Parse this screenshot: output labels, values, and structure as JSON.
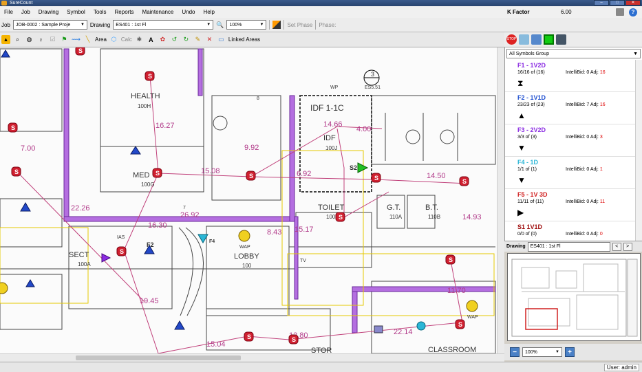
{
  "app": {
    "title": "SureCount"
  },
  "menu": [
    "File",
    "Job",
    "Drawing",
    "Symbol",
    "Tools",
    "Reports",
    "Maintenance",
    "Undo",
    "Help"
  ],
  "kfactor": {
    "label": "K Factor",
    "value": "6.00"
  },
  "toolbar": {
    "job_label": "Job",
    "job_value": "JOB-0002 : Sample Proje",
    "drawing_label": "Drawing",
    "drawing_value": "ES401 : 1st Fl",
    "zoom_value": "100%",
    "set_phase": "Set Phase",
    "phase_label": "Phase:",
    "area_label": "Area",
    "calc_label": "Calc",
    "linked_areas": "Linked Areas"
  },
  "symbols": {
    "group": "All Symbols Group",
    "items": [
      {
        "name": "F1 - 1V2D",
        "color": "#8a2be2",
        "count": "16/16 of (16)",
        "ib": "IntelliBid: 0",
        "adj_label": "Adj:",
        "adj": "16",
        "icon": "hourglass-icon"
      },
      {
        "name": "F2 - 1V1D",
        "color": "#1f4fd0",
        "count": "23/23 of (23)",
        "ib": "IntelliBid: 7",
        "adj_label": "Adj:",
        "adj": "16",
        "icon": "triangle-icon"
      },
      {
        "name": "F3 - 2V2D",
        "color": "#8a2be2",
        "count": "3/3 of (3)",
        "ib": "IntelliBid: 0",
        "adj_label": "Adj:",
        "adj": "3",
        "icon": "down-triangle-icon"
      },
      {
        "name": "F4 - 1D",
        "color": "#2bb6d6",
        "count": "1/1 of (1)",
        "ib": "IntelliBid: 0",
        "adj_label": "Adj:",
        "adj": "1",
        "icon": "down-triangle-icon"
      },
      {
        "name": "F5 - 1V 3D",
        "color": "#d02020",
        "count": "11/11 of (11)",
        "ib": "IntelliBid: 0",
        "adj_label": "Adj:",
        "adj": "11",
        "icon": "play-icon"
      },
      {
        "name": "S1 1V1D",
        "color": "#a01010",
        "count": "0/0 of (0)",
        "ib": "IntelliBid: 0",
        "adj_label": "Adj:",
        "adj": "0",
        "icon": "square-icon"
      }
    ]
  },
  "drawing_panel": {
    "label": "Drawing",
    "value": "ES401 : 1st Fl"
  },
  "zoom_panel": {
    "value": "100%"
  },
  "status": {
    "user": "User: admin"
  },
  "plan": {
    "rooms": [
      "HEALTH",
      "100H",
      "MED",
      "100G",
      "IDF 1-1C",
      "IDF",
      "100J",
      "TOILET",
      "100K",
      "G.T.",
      "110A",
      "B.T.",
      "110B",
      "SECT",
      "100A",
      "LOBBY",
      "100",
      "CLASSROOM",
      "STOR"
    ],
    "measurements": [
      "16.27",
      "15.08",
      "9.92",
      "14.66",
      "4.00",
      "6.92",
      "14.50",
      "22.26",
      "7.00",
      "26.92",
      "8.43",
      "15.17",
      "19.45",
      "15.04",
      "12.80",
      "22.14",
      "11.70",
      "14.93",
      "16.30"
    ],
    "tags": [
      "S2",
      "WAP",
      "IAS",
      "TV",
      "F2",
      "F4",
      "ES5.51",
      "3",
      "8",
      "7",
      "WP"
    ]
  }
}
